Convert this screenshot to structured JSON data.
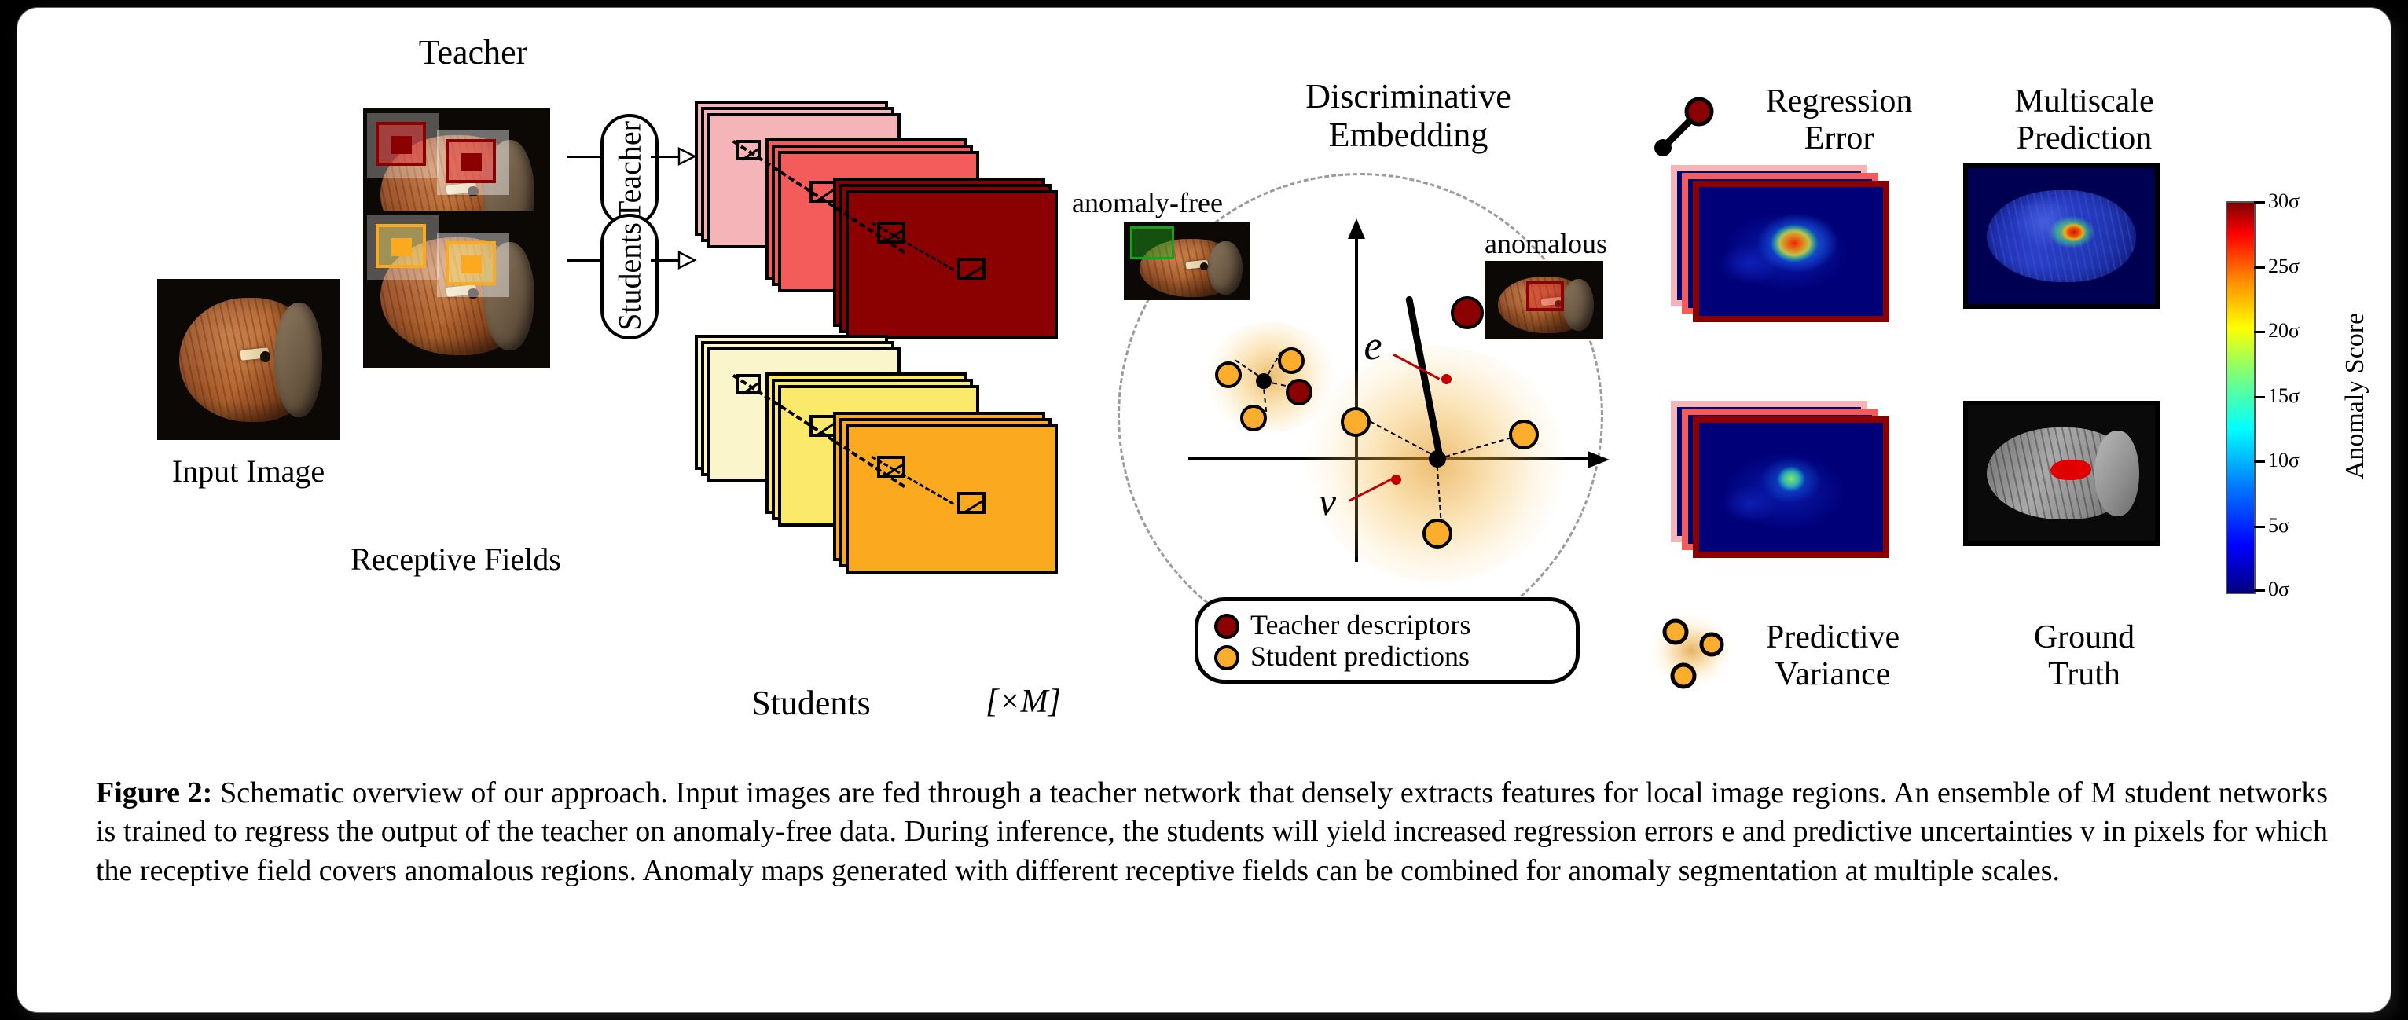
{
  "figure": {
    "labels": {
      "input_image": "Input Image",
      "receptive_fields": "Receptive Fields",
      "teacher_pill": "Teacher",
      "students_pill": "Students",
      "teacher_stack": "Teacher",
      "students_stack": "Students",
      "times_m": "[×M]",
      "discriminative_embedding": "Discriminative\nEmbedding",
      "anomaly_free": "anomaly-free",
      "anomalous": "anomalous",
      "e_symbol": "e",
      "v_symbol": "v",
      "regression_error": "Regression\nError",
      "multiscale_prediction": "Multiscale\nPrediction",
      "predictive_variance": "Predictive\nVariance",
      "ground_truth": "Ground\nTruth"
    },
    "legend": {
      "items": [
        {
          "label": "Teacher descriptors",
          "color": "#8B0000"
        },
        {
          "label": "Student predictions",
          "color": "#FBAE2E"
        }
      ]
    },
    "colorbar": {
      "title": "Anomaly Score",
      "ticks": [
        "30σ",
        "25σ",
        "20σ",
        "15σ",
        "10σ",
        "5σ",
        "0σ"
      ],
      "colormap": "jet",
      "min": "0σ",
      "max": "30σ"
    },
    "colors": {
      "teacher_scale_light": "#F4B4B8",
      "teacher_scale_mid": "#F45B5B",
      "teacher_scale_dark": "#8B0000",
      "student_scale_light": "#FBF5CC",
      "student_scale_mid": "#FBE96B",
      "student_scale_dark": "#FBA91E",
      "teacher_descriptor": "#8B0000",
      "student_prediction": "#FBAE2E",
      "anomaly_free_box": "#1AA01A",
      "anomalous_box": "#C01010",
      "annotation_red": "#C00000",
      "dash_circle": "#9B9B9B"
    }
  },
  "caption": {
    "label": "Figure 2:",
    "text": " Schematic overview of our approach. Input images are fed through a teacher network that densely extracts features for local image regions. An ensemble of M student networks is trained to regress the output of the teacher on anomaly-free data. During inference, the students will yield increased regression errors e and predictive uncertainties v in pixels for which the receptive field covers anomalous regions. Anomaly maps generated with different receptive fields can be combined for anomaly segmentation at multiple scales."
  }
}
